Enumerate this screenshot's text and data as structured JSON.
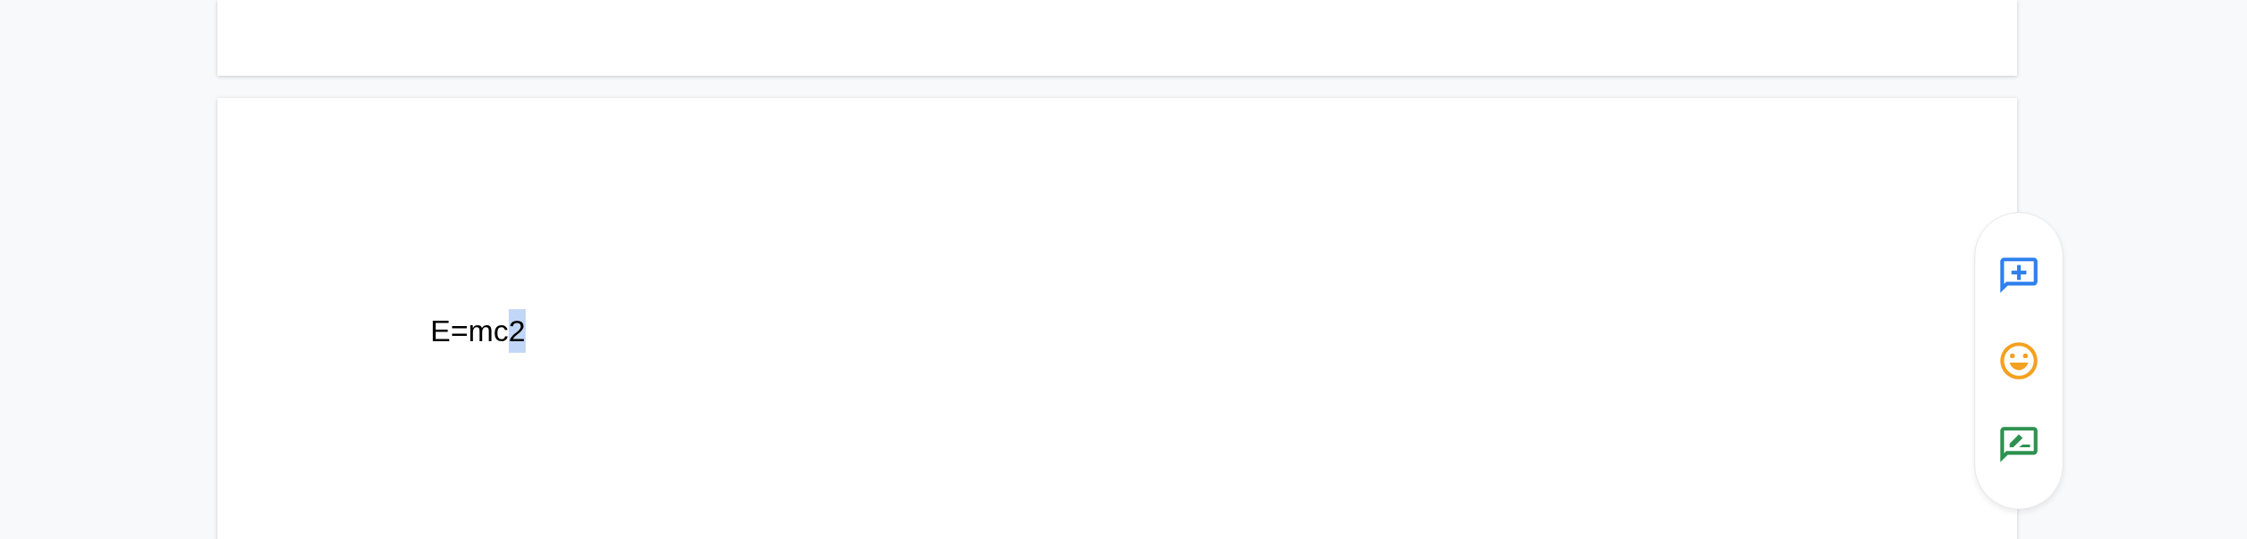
{
  "document": {
    "paragraphs": [
      {
        "runs": [
          {
            "text": "E=mc",
            "selected": false
          },
          {
            "text": "2",
            "selected": true
          }
        ]
      }
    ]
  }
}
